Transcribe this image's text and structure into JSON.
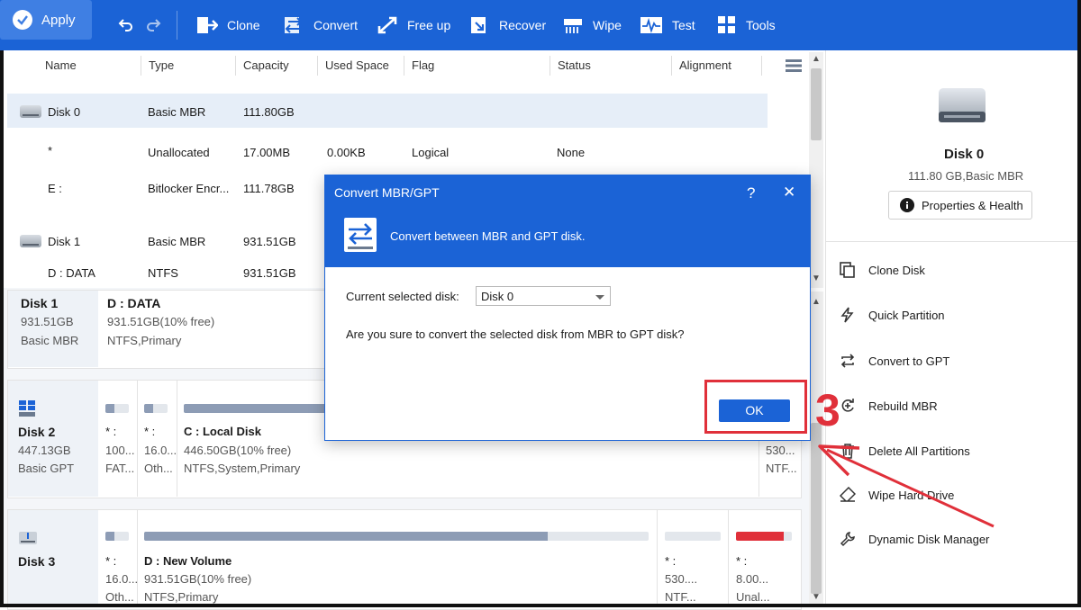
{
  "toolbar": {
    "apply": "Apply",
    "clone": "Clone",
    "convert": "Convert",
    "free_up": "Free up",
    "recover": "Recover",
    "wipe": "Wipe",
    "test": "Test",
    "tools": "Tools"
  },
  "table": {
    "headers": [
      "Name",
      "Type",
      "Capacity",
      "Used Space",
      "Flag",
      "Status",
      "Alignment"
    ],
    "rows": [
      {
        "name": "Disk 0",
        "type": "Basic MBR",
        "capacity": "111.80GB",
        "used": "",
        "flag": "",
        "status": ""
      },
      {
        "name": "*",
        "type": "Unallocated",
        "capacity": "17.00MB",
        "used": "0.00KB",
        "flag": "Logical",
        "status": "None"
      },
      {
        "name": "E :",
        "type": "Bitlocker Encr...",
        "capacity": "111.78GB",
        "used": "",
        "flag": "",
        "status": ""
      },
      {
        "name": "Disk 1",
        "type": "Basic MBR",
        "capacity": "931.51GB",
        "used": "",
        "flag": "",
        "status": ""
      },
      {
        "name": "D : DATA",
        "type": "NTFS",
        "capacity": "931.51GB",
        "used": "",
        "flag": "",
        "status": ""
      }
    ]
  },
  "diskmap": {
    "disk1": {
      "name": "Disk 1",
      "size": "931.51GB",
      "type": "Basic MBR",
      "part": {
        "name": "D : DATA",
        "size": "931.51GB(10% free)",
        "fs": "NTFS,Primary"
      }
    },
    "disk2": {
      "name": "Disk 2",
      "size": "447.13GB",
      "type": "Basic GPT",
      "p1": {
        "name": "* :",
        "size": "100...",
        "fs": "FAT..."
      },
      "p2": {
        "name": "* :",
        "size": "16.0...",
        "fs": "Oth..."
      },
      "p3": {
        "name": "C : Local Disk",
        "size": "446.50GB(10% free)",
        "fs": "NTFS,System,Primary",
        "used_fraction": 0.9
      },
      "p4": {
        "size": "530...",
        "fs": "NTF..."
      }
    },
    "disk3": {
      "name": "Disk 3",
      "p1": {
        "name": "* :",
        "size": "16.0...",
        "fs": "Oth..."
      },
      "p2": {
        "name": "D : New Volume",
        "size": "931.51GB(10% free)",
        "fs": "NTFS,Primary",
        "used_fraction": 0.8
      },
      "p3": {
        "name": "* :",
        "size": "530....",
        "fs": "NTF..."
      },
      "p4": {
        "name": "* :",
        "size": "8.00...",
        "fs": "Unal..."
      }
    }
  },
  "right_panel": {
    "disk_name": "Disk 0",
    "disk_info": "111.80 GB,Basic MBR",
    "properties_button": "Properties & Health",
    "operations": [
      "Clone Disk",
      "Quick Partition",
      "Convert to GPT",
      "Rebuild MBR",
      "Delete All Partitions",
      "Wipe Hard Drive",
      "Dynamic Disk Manager"
    ]
  },
  "dialog": {
    "title": "Convert MBR/GPT",
    "help": "?",
    "close": "✕",
    "subtitle": "Convert between MBR and GPT disk.",
    "current_label": "Current selected disk:",
    "current_value": "Disk 0",
    "question": "Are you sure to convert the selected disk from MBR to GPT disk?",
    "ok": "OK"
  },
  "annotation": {
    "step": "3",
    "color": "#e0303a"
  },
  "colors": {
    "accent": "#1b63d6",
    "bar_fill": "#8d9cb5",
    "unalloc": "#e0303a"
  }
}
